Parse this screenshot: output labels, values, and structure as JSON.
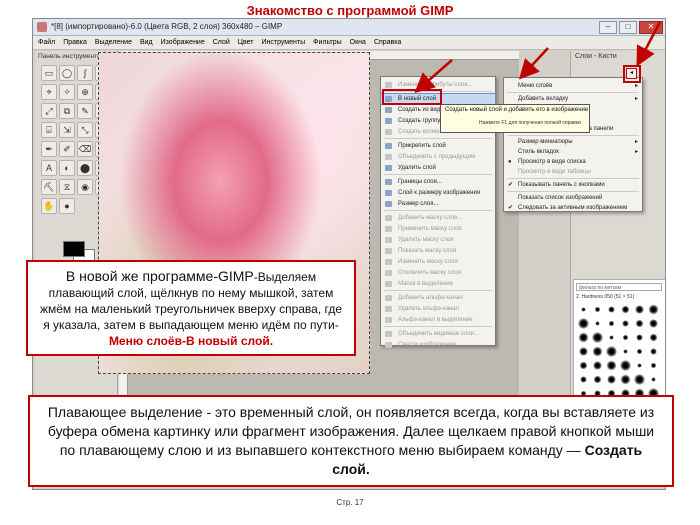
{
  "slide": {
    "title": "Знакомство с программой GIMP",
    "page": "Стр. 17"
  },
  "window": {
    "title": "*[8] (импортировано)-6.0 (Цвета RGB, 2 слоя) 360x480 – GIMP",
    "minimize": "–",
    "maximize": "□",
    "close": "✕"
  },
  "menubar": [
    "Файл",
    "Правка",
    "Выделение",
    "Вид",
    "Изображение",
    "Слой",
    "Цвет",
    "Инструменты",
    "Фильтры",
    "Окна",
    "Справка"
  ],
  "toolbox": {
    "header": "Панель инструментов - Г",
    "tools": [
      "▭",
      "◯",
      "ʃ",
      "✂",
      "⌖",
      "✧",
      "⊕",
      "✥",
      "⤢",
      "⧉",
      "✎",
      "⬡",
      "⌸",
      "⇲",
      "⤡",
      "⟳",
      "✒",
      "✐",
      "⌫",
      "⬮",
      "A",
      "◐",
      "⬤",
      "✦",
      "⛏",
      "⧖",
      "◉",
      "✺",
      "✋",
      "●"
    ]
  },
  "context_menu": {
    "items": [
      {
        "label": "Изменить атрибуты слоя...",
        "disabled": true
      },
      {
        "label": "В новый слой",
        "disabled": false,
        "highlight": true
      },
      {
        "label": "Создать из видимого",
        "disabled": false
      },
      {
        "label": "Создать группу слоёв",
        "disabled": false
      },
      {
        "label": "Создать копию слоя",
        "disabled": true
      },
      {
        "label": "Прикрепить слой",
        "disabled": false
      },
      {
        "label": "Объединить с предыдущим",
        "disabled": true
      },
      {
        "label": "Удалить слой",
        "disabled": false
      },
      {
        "label": "Границы слоя...",
        "disabled": false
      },
      {
        "label": "Слой к размеру изображения",
        "disabled": false
      },
      {
        "label": "Размер слоя...",
        "disabled": false
      },
      {
        "label": "Добавить маску слоя...",
        "disabled": true
      },
      {
        "label": "Применить маску слоя",
        "disabled": true
      },
      {
        "label": "Удалить маску слоя",
        "disabled": true
      },
      {
        "label": "Показать маску слоя",
        "disabled": true
      },
      {
        "label": "Изменить маску слоя",
        "disabled": true
      },
      {
        "label": "Отключить маску слоя",
        "disabled": true
      },
      {
        "label": "Маска в выделение",
        "disabled": true
      },
      {
        "label": "Добавить альфа-канал",
        "disabled": true
      },
      {
        "label": "Удалить альфа-канал",
        "disabled": true
      },
      {
        "label": "Альфа-канал в выделение",
        "disabled": true
      },
      {
        "label": "Объединить видимые слои...",
        "disabled": true
      },
      {
        "label": "Свести изображение",
        "disabled": true
      }
    ]
  },
  "right_panel": {
    "header": "Слои - Кисти",
    "tab_menu_button": "◂"
  },
  "sub_menu": {
    "items": [
      {
        "label": "Меню слоёв",
        "arrow": true,
        "check": ""
      },
      {
        "label": "Добавить вкладку",
        "arrow": true,
        "check": ""
      },
      {
        "label": "Закрыть вкладку",
        "arrow": false,
        "check": ""
      },
      {
        "label": "Прикрепить вкладку",
        "arrow": false,
        "check": ""
      },
      {
        "label": "Заблокировать вкладку на панели",
        "arrow": false,
        "check": ""
      },
      {
        "label": "Размер миниатюры",
        "arrow": true,
        "check": ""
      },
      {
        "label": "Стиль вкладок",
        "arrow": true,
        "check": ""
      },
      {
        "label": "Просмотр в виде списка",
        "arrow": false,
        "check": "●"
      },
      {
        "label": "Просмотр в виде таблицы",
        "arrow": false,
        "check": "",
        "disabled": true
      },
      {
        "label": "Показывать панель с кнопками",
        "arrow": false,
        "check": "✔"
      },
      {
        "label": "Показать список изображений",
        "arrow": false,
        "check": ""
      },
      {
        "label": "Следовать за активным изображением",
        "arrow": false,
        "check": "✔"
      }
    ]
  },
  "tooltip": {
    "line1": "Создать новый слой и добавить его в изображение",
    "line2": "Нажмите F1 для получения полной справки"
  },
  "brushes": {
    "filter": "фильтр по меткам",
    "name": "2. Hardness 050 (51 × 51)"
  },
  "callout1": {
    "part1": "В новой же программе-GIMP",
    "part2": "-Выделяем плавающий слой, щёлкнув по нему мышкой, затем жмём на маленький треугольничек вверху справа, где  я указала, затем в выпадающем меню идём по пути- ",
    "part3": "Меню слоёв-В новый слой."
  },
  "callout2": {
    "text": "Плавающее выделение - это временный слой, он появляется всегда, когда вы вставляете из буфера обмена картинку или фрагмент изображения. Далее щелкаем правой кнопкой мыши по плавающему слою и из выпавшего контекстного меню выбираем команду — ",
    "bold": "Создать слой."
  },
  "colors": {
    "accent_red": "#c00000",
    "highlight": "#c7d8f0"
  }
}
